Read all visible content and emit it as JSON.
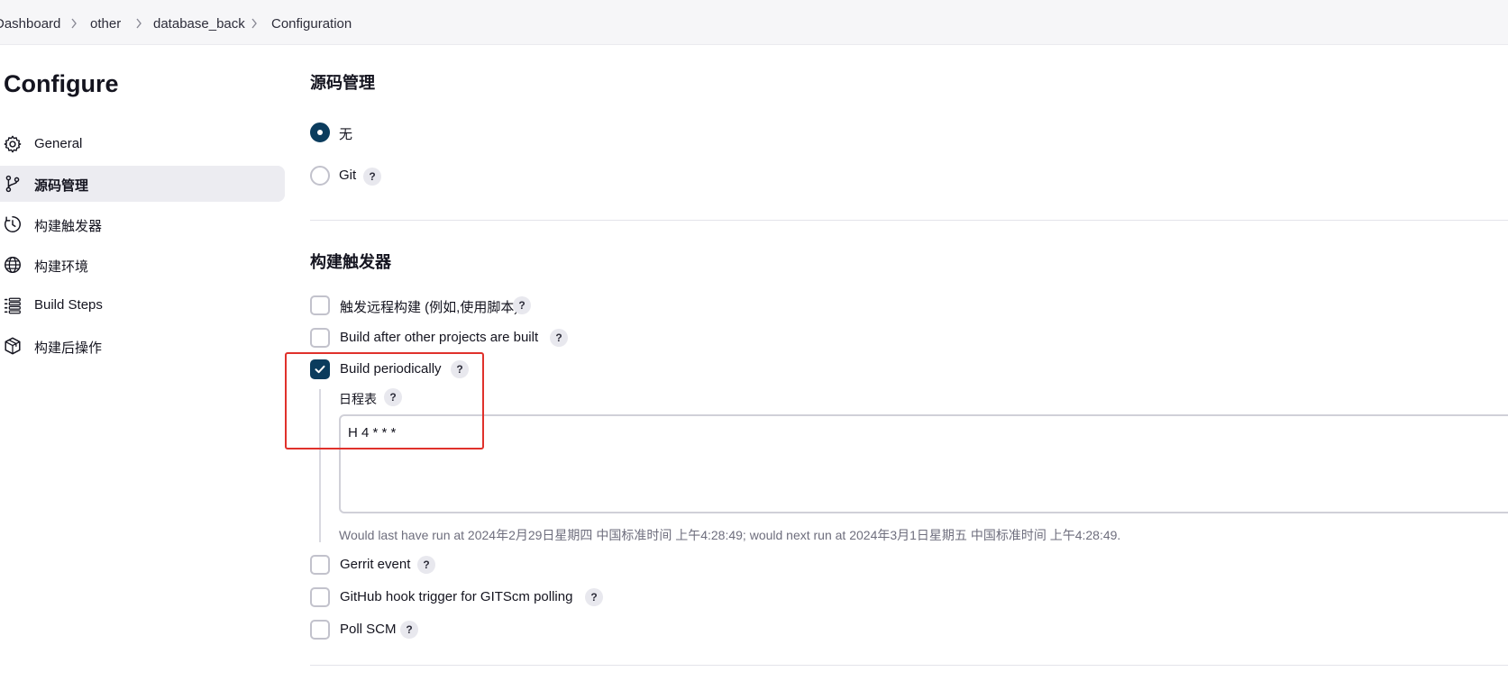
{
  "breadcrumb": {
    "items": [
      "Dashboard",
      "other",
      "database_back",
      "Configuration"
    ]
  },
  "page": {
    "title": "Configure"
  },
  "sidebar": {
    "items": [
      {
        "label": "General",
        "icon": "gear-icon"
      },
      {
        "label": "源码管理",
        "icon": "branch-icon",
        "active": true
      },
      {
        "label": "构建触发器",
        "icon": "clock-icon"
      },
      {
        "label": "构建环境",
        "icon": "globe-icon"
      },
      {
        "label": "Build Steps",
        "icon": "list-icon"
      },
      {
        "label": "构建后操作",
        "icon": "package-icon"
      }
    ]
  },
  "scm": {
    "title": "源码管理",
    "options": [
      {
        "label": "无",
        "selected": true
      },
      {
        "label": "Git",
        "selected": false,
        "help": "?"
      }
    ]
  },
  "triggers": {
    "title": "构建触发器",
    "options": [
      {
        "label": "触发远程构建 (例如,使用脚本)",
        "checked": false,
        "help": "?"
      },
      {
        "label": "Build after other projects are built",
        "checked": false,
        "help": "?"
      },
      {
        "label": "Build periodically",
        "checked": true,
        "help": "?"
      },
      {
        "label": "Gerrit event",
        "checked": false,
        "help": "?"
      },
      {
        "label": "GitHub hook trigger for GITScm polling",
        "checked": false,
        "help": "?"
      },
      {
        "label": "Poll SCM",
        "checked": false,
        "help": "?"
      }
    ],
    "schedule": {
      "label": "日程表",
      "help": "?",
      "value": "H 4 * * *",
      "info": "Would last have run at 2024年2月29日星期四 中国标准时间 上午4:28:49; would next run at 2024年3月1日星期五 中国标准时间 上午4:28:49."
    }
  },
  "colors": {
    "accent": "#0b3c5d",
    "highlight": "#e0312b"
  }
}
